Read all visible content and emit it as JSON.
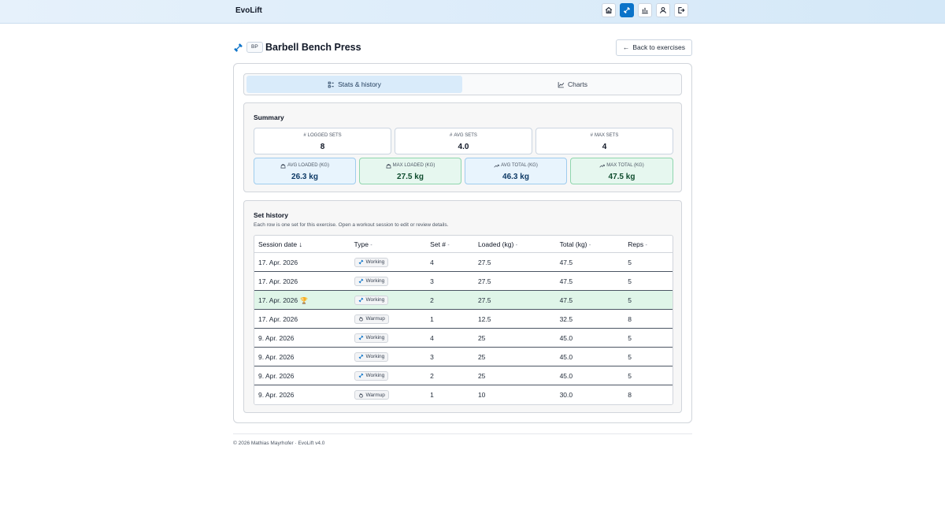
{
  "app": {
    "name": "EvoLift"
  },
  "nav": [
    {
      "name": "home-icon"
    },
    {
      "name": "dumbbell-icon",
      "active": true
    },
    {
      "name": "bar-chart-icon"
    },
    {
      "name": "user-icon"
    },
    {
      "name": "logout-icon"
    }
  ],
  "exercise": {
    "abbr": "BP",
    "title": "Barbell Bench Press"
  },
  "back_button": {
    "label": "Back to exercises"
  },
  "tabs": [
    {
      "label": "Stats & history",
      "active": true
    },
    {
      "label": "Charts"
    }
  ],
  "summary": {
    "title": "Summary",
    "stats": [
      {
        "label": "LOGGED SETS",
        "value": "8"
      },
      {
        "label": "AVG SETS",
        "value": "4.0"
      },
      {
        "label": "MAX SETS",
        "value": "4"
      },
      {
        "label": "AVG LOADED (KG)",
        "value": "26.3 kg"
      },
      {
        "label": "MAX LOADED (KG)",
        "value": "27.5 kg"
      },
      {
        "label": "AVG TOTAL (KG)",
        "value": "46.3 kg"
      },
      {
        "label": "MAX TOTAL (KG)",
        "value": "47.5 kg"
      }
    ]
  },
  "history": {
    "title": "Set history",
    "subtitle": "Each row is one set for this exercise. Open a workout session to edit or review details.",
    "columns": [
      "Session date",
      "Type",
      "Set #",
      "Loaded (kg)",
      "Total (kg)",
      "Reps"
    ],
    "sort_desc": "↓",
    "sort_none": "-",
    "rows": [
      {
        "date": "17. Apr. 2026",
        "type": "Working",
        "set": "4",
        "loaded": "27.5",
        "total": "47.5",
        "reps": "5"
      },
      {
        "date": "17. Apr. 2026",
        "type": "Working",
        "set": "3",
        "loaded": "27.5",
        "total": "47.5",
        "reps": "5"
      },
      {
        "date": "17. Apr. 2026",
        "type": "Working",
        "set": "2",
        "loaded": "27.5",
        "total": "47.5",
        "reps": "5",
        "highlight": true
      },
      {
        "date": "17. Apr. 2026",
        "type": "Warmup",
        "set": "1",
        "loaded": "12.5",
        "total": "32.5",
        "reps": "8"
      },
      {
        "date": "9. Apr. 2026",
        "type": "Working",
        "set": "4",
        "loaded": "25",
        "total": "45.0",
        "reps": "5"
      },
      {
        "date": "9. Apr. 2026",
        "type": "Working",
        "set": "3",
        "loaded": "25",
        "total": "45.0",
        "reps": "5"
      },
      {
        "date": "9. Apr. 2026",
        "type": "Working",
        "set": "2",
        "loaded": "25",
        "total": "45.0",
        "reps": "5"
      },
      {
        "date": "9. Apr. 2026",
        "type": "Warmup",
        "set": "1",
        "loaded": "10",
        "total": "30.0",
        "reps": "8"
      }
    ]
  },
  "footer": {
    "text": "© 2026 Mathias Mayrhofer · EvoLift v4.0"
  },
  "colors": {
    "accent": "#0b73c9",
    "highlight_row": "#dff5e8",
    "blue_card": "#e8f4fd",
    "green_card": "#e6f7ef"
  }
}
